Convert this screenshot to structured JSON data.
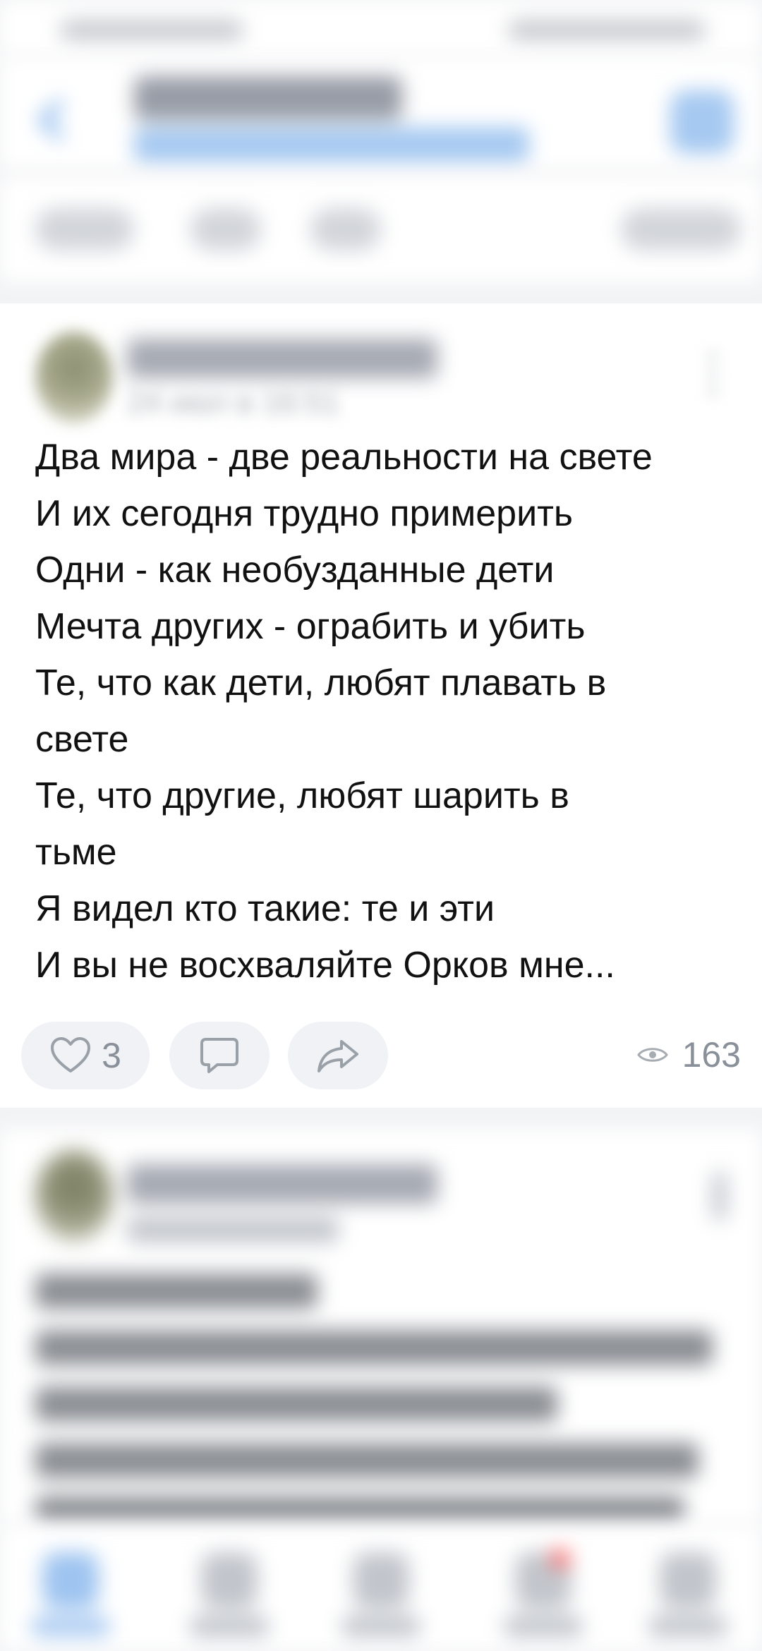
{
  "post": {
    "date": "24 июл в 16:51",
    "lines": [
      "Два мира - две реальности на свете",
      "И их сегодня трудно примерить",
      "Одни - как необузданные дети",
      "Мечта других - ограбить и убить",
      "Те, что как дети, любят плавать в",
      "свете",
      "Те, что другие, любят шарить в",
      "тьме",
      "Я видел кто такие: те и эти",
      "И вы не восхваляйте Орков мне..."
    ],
    "likes": "3",
    "views": "163"
  },
  "icons": {
    "back": "back-arrow-icon",
    "edit": "edit-icon",
    "more": "more-icon",
    "like": "heart-icon",
    "comment": "comment-icon",
    "share": "share-icon",
    "views": "eye-icon"
  },
  "colors": {
    "accent": "#5d9ce6",
    "text": "#111111",
    "muted": "#8a9099",
    "background": "#f2f3f5"
  }
}
